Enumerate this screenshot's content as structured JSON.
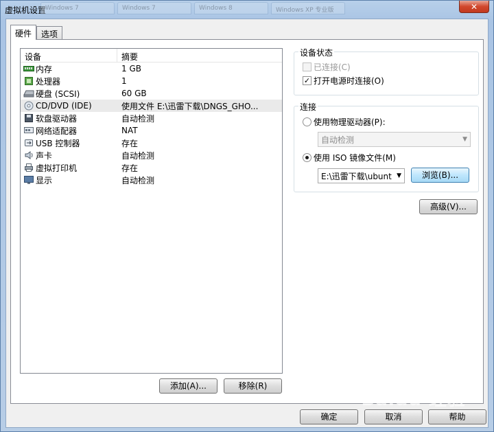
{
  "window": {
    "title": "虚拟机设置",
    "background_tabs": [
      "Windows 7",
      "Windows 7",
      "Windows 8",
      "Windows XP 专业版"
    ],
    "close_glyph": "✕"
  },
  "tabs": [
    {
      "label": "硬件",
      "active": true
    },
    {
      "label": "选项",
      "active": false
    }
  ],
  "device_list": {
    "columns": [
      "设备",
      "摘要"
    ],
    "rows": [
      {
        "name": "内存",
        "summary": "1 GB",
        "icon": "memory-icon"
      },
      {
        "name": "处理器",
        "summary": "1",
        "icon": "processor-icon"
      },
      {
        "name": "硬盘 (SCSI)",
        "summary": "60 GB",
        "icon": "harddisk-icon"
      },
      {
        "name": "CD/DVD (IDE)",
        "summary": "使用文件 E:\\迅雷下载\\DNGS_GHO...",
        "icon": "cdrom-icon",
        "selected": true
      },
      {
        "name": "软盘驱动器",
        "summary": "自动检测",
        "icon": "floppy-icon"
      },
      {
        "name": "网络适配器",
        "summary": "NAT",
        "icon": "network-adapter-icon"
      },
      {
        "name": "USB 控制器",
        "summary": "存在",
        "icon": "usb-icon"
      },
      {
        "name": "声卡",
        "summary": "自动检测",
        "icon": "sound-card-icon"
      },
      {
        "name": "虚拟打印机",
        "summary": "存在",
        "icon": "printer-icon"
      },
      {
        "name": "显示",
        "summary": "自动检测",
        "icon": "display-icon"
      }
    ]
  },
  "list_buttons": {
    "add": "添加(A)...",
    "remove": "移除(R)"
  },
  "device_status": {
    "label": "设备状态",
    "connected": {
      "label": "已连接(C)",
      "checked": false,
      "enabled": false
    },
    "connect_on_power": {
      "label": "打开电源时连接(O)",
      "checked": true,
      "enabled": true
    }
  },
  "connection": {
    "label": "连接",
    "physical": {
      "label": "使用物理驱动器(P):",
      "selected": false
    },
    "physical_combo": "自动检测",
    "iso": {
      "label": "使用 ISO 镜像文件(M)",
      "selected": true
    },
    "iso_combo": "E:\\迅雷下载\\ubunt",
    "browse": "浏览(B)..."
  },
  "advanced_button": "高级(V)...",
  "footer": {
    "ok": "确定",
    "cancel": "取消",
    "help": "帮助"
  },
  "watermark": "Baidu 经验"
}
